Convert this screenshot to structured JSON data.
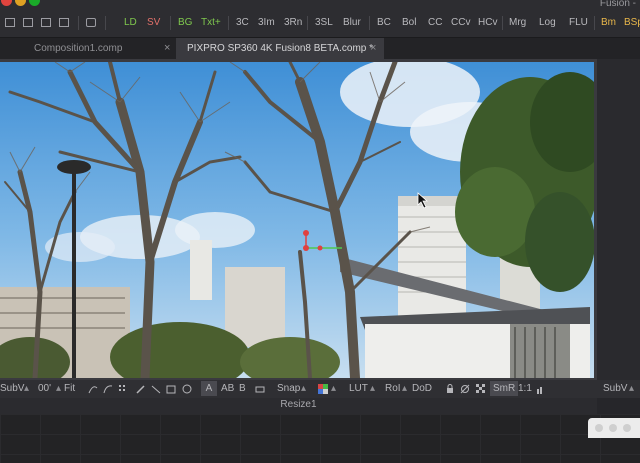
{
  "app": {
    "title": "Fusion -"
  },
  "toolbar": {
    "buttons": [
      {
        "label": "LD",
        "color": "#7fc84e"
      },
      {
        "label": "SV",
        "color": "#e0706a"
      },
      {
        "label": "BG",
        "color": "#7fc84e"
      },
      {
        "label": "Txt+",
        "color": "#7fc84e"
      },
      {
        "label": "3C",
        "color": "#b9b9bd"
      },
      {
        "label": "3Im",
        "color": "#b9b9bd"
      },
      {
        "label": "3Rn",
        "color": "#b9b9bd"
      },
      {
        "label": "3SL",
        "color": "#b9b9bd"
      },
      {
        "label": "Blur",
        "color": "#b9b9bd"
      },
      {
        "label": "BC",
        "color": "#b9b9bd"
      },
      {
        "label": "Bol",
        "color": "#b9b9bd"
      },
      {
        "label": "CC",
        "color": "#b9b9bd"
      },
      {
        "label": "CCv",
        "color": "#b9b9bd"
      },
      {
        "label": "HCv",
        "color": "#b9b9bd"
      },
      {
        "label": "Mrg",
        "color": "#b9b9bd"
      },
      {
        "label": "Log",
        "color": "#b9b9bd"
      },
      {
        "label": "FLU",
        "color": "#b9b9bd"
      },
      {
        "label": "Bm",
        "color": "#e8b64a"
      },
      {
        "label": "BSp",
        "color": "#e8b64a"
      }
    ]
  },
  "tabs": [
    {
      "label": "Composition1.comp",
      "active": false
    },
    {
      "label": "PIXPRO SP360 4K Fusion8 BETA.comp *",
      "active": true
    }
  ],
  "tab_close_glyph": "×",
  "viewer_bar": {
    "subview": "SubV",
    "zoom": "00'",
    "fit": "Fit",
    "a_btn": "A",
    "ab_btn": "AB",
    "b_btn": "B",
    "snap": "Snap",
    "lut": "LUT",
    "roi": "RoI",
    "dod": "DoD",
    "smr": "SmR",
    "ratio": "1:1",
    "right_subview": "SubV"
  },
  "viewer": {
    "node_name": "Resize1"
  }
}
